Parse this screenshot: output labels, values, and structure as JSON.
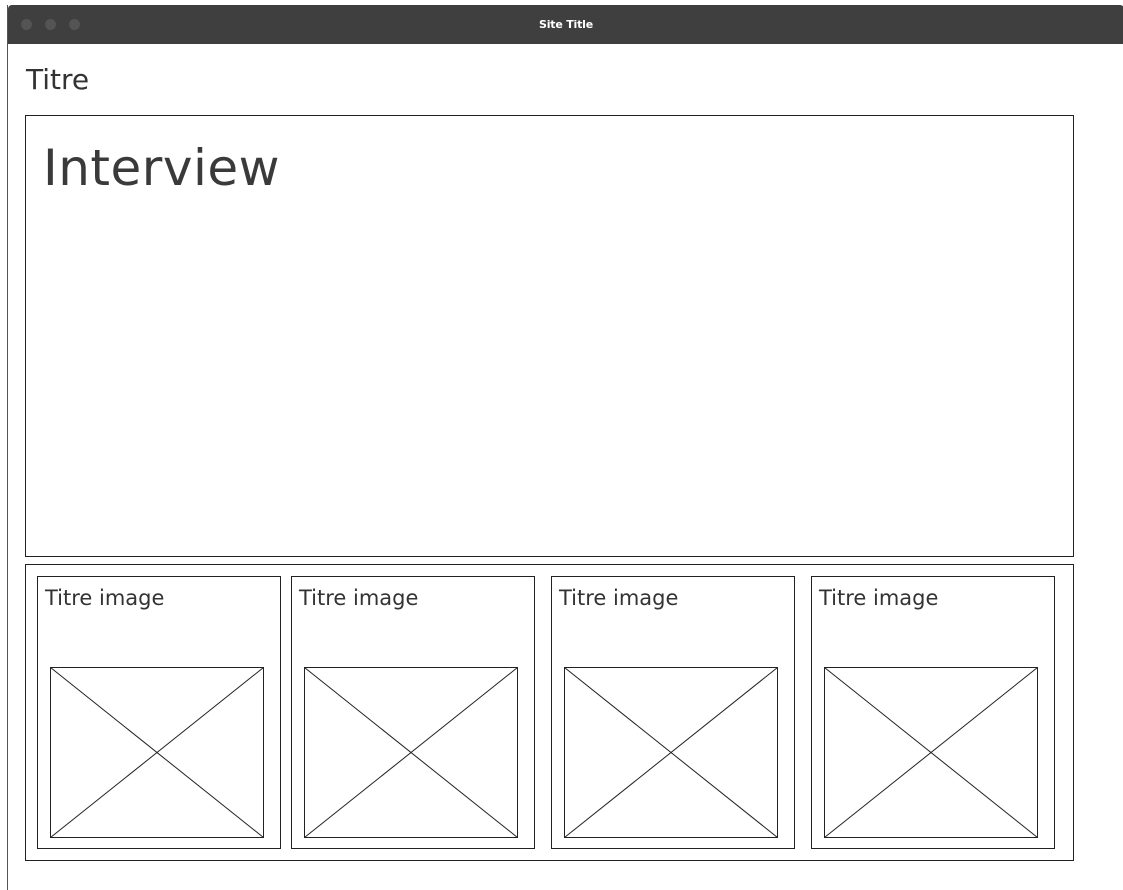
{
  "window": {
    "title": "Site Title"
  },
  "page": {
    "title": "Titre"
  },
  "interview": {
    "heading": "Interview"
  },
  "gallery": {
    "cards": [
      {
        "title": "Titre image",
        "image": "image-placeholder-icon"
      },
      {
        "title": "Titre image",
        "image": "image-placeholder-icon"
      },
      {
        "title": "Titre image",
        "image": "image-placeholder-icon"
      },
      {
        "title": "Titre image",
        "image": "image-placeholder-icon"
      }
    ]
  },
  "colors": {
    "titlebar": "#3f3f3f",
    "border": "#222222",
    "text": "#333333"
  }
}
